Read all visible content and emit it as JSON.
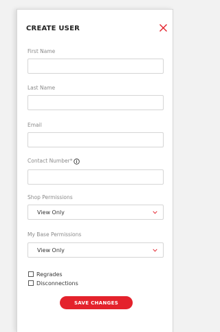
{
  "colors": {
    "accent": "#e4222c",
    "border": "#d5d5d5",
    "label": "#8a8a8a",
    "text": "#333333"
  },
  "panel": {
    "title": "CREATE USER",
    "close_icon": "close-icon"
  },
  "fields": {
    "first_name": {
      "label": "First Name",
      "value": ""
    },
    "last_name": {
      "label": "Last Name",
      "value": ""
    },
    "email": {
      "label": "Email",
      "value": ""
    },
    "contact_number": {
      "label": "Contact Number*",
      "value": "",
      "icon": "info-icon"
    }
  },
  "permissions": {
    "shop": {
      "label": "Shop Permissions",
      "selected": "View Only",
      "icon": "chevron-down-icon"
    },
    "my_base": {
      "label": "My Base Permissions",
      "selected": "View Only",
      "icon": "chevron-down-icon"
    }
  },
  "checkboxes": {
    "regrades": {
      "label": "Regrades",
      "checked": false
    },
    "disconnections": {
      "label": "Disconnections",
      "checked": false
    }
  },
  "actions": {
    "save_label": "SAVE CHANGES"
  }
}
